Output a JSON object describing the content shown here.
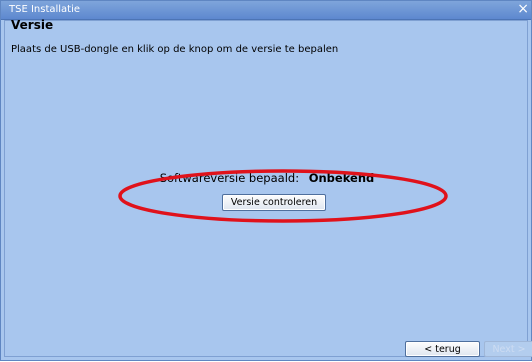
{
  "window": {
    "title": "TSE Installatie",
    "close_glyph": "×"
  },
  "page": {
    "heading": "Versie",
    "instruction": "Plaats de USB-dongle en klik op de knop om de versie te bepalen"
  },
  "status": {
    "label": "Softwareversie bepaald:",
    "value": "Onbekend"
  },
  "buttons": {
    "check": "Versie controleren",
    "back": "< terug",
    "next": "Next >"
  },
  "colors": {
    "window_bg": "#a8c6ee",
    "titlebar": "#6b93d4",
    "highlight": "#e0121b"
  },
  "icons": {
    "close": "close-icon"
  }
}
